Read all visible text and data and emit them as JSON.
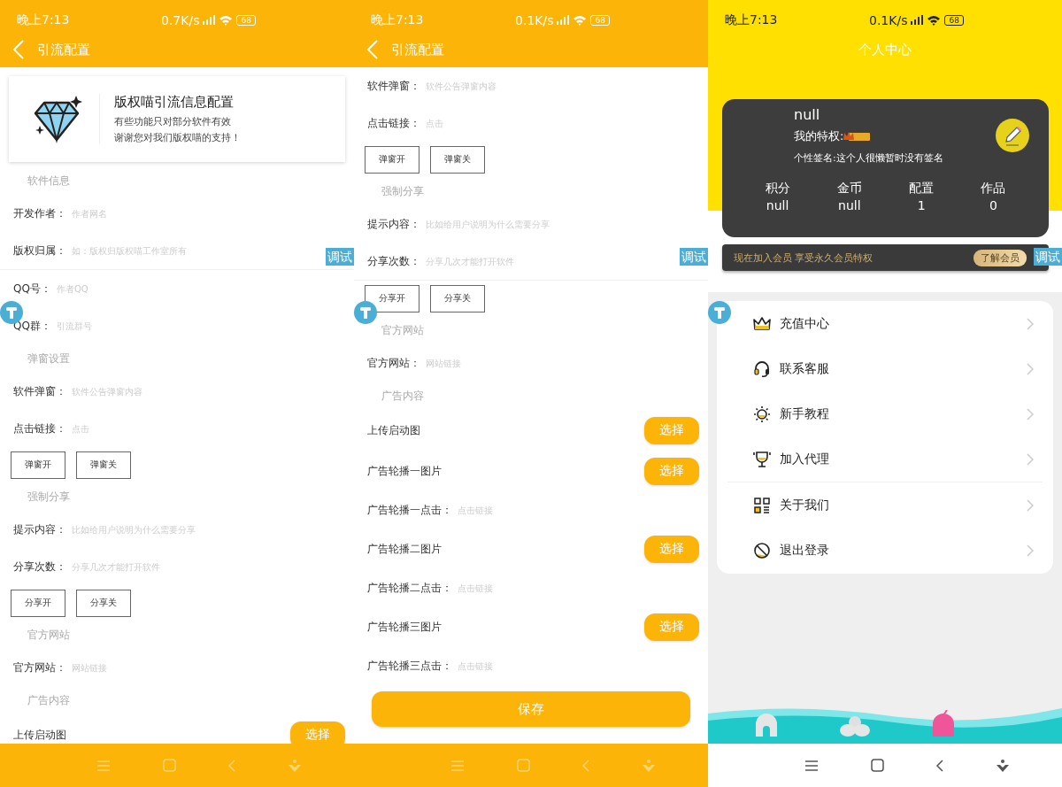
{
  "screens": [
    {
      "kind": "form",
      "status_bar": {
        "time": "晚上7:13",
        "speed": "0.7K/s",
        "battery": "68"
      },
      "title": "引流配置",
      "banner": {
        "title": "版权喵引流信息配置",
        "lines": [
          "有些功能只对部分软件有效",
          "谢谢您对我们版权喵的支持！"
        ]
      },
      "rows": [
        {
          "kind": "section",
          "label": "软件信息"
        },
        {
          "kind": "field",
          "label": "开发作者：",
          "placeholder": "作者网名"
        },
        {
          "kind": "field",
          "label": "版权归属：",
          "placeholder": "如：版权归版权喵工作室所有",
          "divider": true
        },
        {
          "kind": "field",
          "label": "QQ号：",
          "placeholder": "作者QQ"
        },
        {
          "kind": "field",
          "label": "QQ群：",
          "placeholder": "引流群号"
        },
        {
          "kind": "section",
          "label": "弹窗设置"
        },
        {
          "kind": "field",
          "label": "软件弹窗：",
          "placeholder": "软件公告弹窗内容"
        },
        {
          "kind": "field",
          "label": "点击链接：",
          "placeholder": "点击"
        },
        {
          "kind": "buttons",
          "labels": [
            "弹窗开",
            "弹窗关"
          ]
        },
        {
          "kind": "section",
          "label": "强制分享"
        },
        {
          "kind": "field",
          "label": "提示内容：",
          "placeholder": "比如给用户说明为什么需要分享"
        },
        {
          "kind": "field",
          "label": "分享次数：",
          "placeholder": "分享几次才能打开软件"
        },
        {
          "kind": "buttons",
          "labels": [
            "分享开",
            "分享关"
          ]
        },
        {
          "kind": "section",
          "label": "官方网站"
        },
        {
          "kind": "field",
          "label": "官方网站：",
          "placeholder": "网站链接"
        },
        {
          "kind": "section",
          "label": "广告内容"
        },
        {
          "kind": "picker",
          "label": "上传启动图",
          "button": "选择"
        }
      ],
      "debug_button": "调试"
    },
    {
      "kind": "form",
      "status_bar": {
        "time": "晚上7:13",
        "speed": "0.1K/s",
        "battery": "68"
      },
      "title": "引流配置",
      "rows": [
        {
          "kind": "field",
          "label": "软件弹窗：",
          "placeholder": "软件公告弹窗内容"
        },
        {
          "kind": "field",
          "label": "点击链接：",
          "placeholder": "点击"
        },
        {
          "kind": "buttons",
          "labels": [
            "弹窗开",
            "弹窗关"
          ]
        },
        {
          "kind": "section",
          "label": "强制分享"
        },
        {
          "kind": "field",
          "label": "提示内容：",
          "placeholder": "比如给用户说明为什么需要分享"
        },
        {
          "kind": "field",
          "label": "分享次数：",
          "placeholder": "分享几次才能打开软件",
          "divider": true
        },
        {
          "kind": "buttons",
          "labels": [
            "分享开",
            "分享关"
          ]
        },
        {
          "kind": "section",
          "label": "官方网站"
        },
        {
          "kind": "field",
          "label": "官方网站：",
          "placeholder": "网站链接"
        },
        {
          "kind": "section",
          "label": "广告内容"
        },
        {
          "kind": "picker",
          "label": "上传启动图",
          "button": "选择"
        },
        {
          "kind": "picker",
          "label": "广告轮播一图片",
          "button": "选择"
        },
        {
          "kind": "field",
          "label": "广告轮播一点击：",
          "placeholder": "点击链接"
        },
        {
          "kind": "picker",
          "label": "广告轮播二图片",
          "button": "选择"
        },
        {
          "kind": "field",
          "label": "广告轮播二点击：",
          "placeholder": "点击链接"
        },
        {
          "kind": "picker",
          "label": "广告轮播三图片",
          "button": "选择"
        },
        {
          "kind": "field",
          "label": "广告轮播三点击：",
          "placeholder": "点击链接"
        }
      ],
      "save_button": "保存",
      "debug_button": "调试"
    },
    {
      "kind": "profile",
      "status_bar": {
        "time": "晚上7:13",
        "speed": "0.1K/s",
        "battery": "68"
      },
      "title": "个人中心",
      "user": {
        "name": "null",
        "privilege_label": "我的特权:",
        "signature": "个性签名:这个人很懒暂时没有签名"
      },
      "stats": [
        {
          "label": "积分",
          "value": "null"
        },
        {
          "label": "金币",
          "value": "null"
        },
        {
          "label": "配置",
          "value": "1"
        },
        {
          "label": "作品",
          "value": "0"
        }
      ],
      "member_bar": {
        "text": "现在加入会员 享受永久会员特权",
        "button": "了解会员"
      },
      "menu_groups": [
        [
          {
            "label": "充值中心"
          },
          {
            "label": "联系客服"
          },
          {
            "label": "新手教程"
          },
          {
            "label": "加入代理"
          }
        ],
        [
          {
            "label": "关于我们"
          },
          {
            "label": "退出登录"
          }
        ]
      ],
      "debug_button": "调试"
    }
  ]
}
